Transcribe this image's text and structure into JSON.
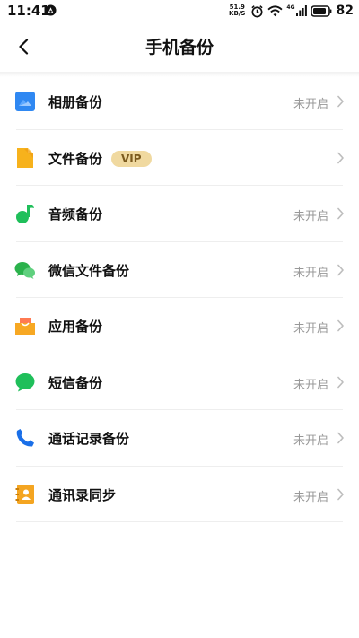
{
  "status_bar": {
    "time": "11:41",
    "net_speed_value": "51.9",
    "net_speed_unit": "KB/S",
    "signal_label": "4G",
    "battery": "82"
  },
  "header": {
    "title": "手机备份"
  },
  "items": [
    {
      "label": "相册备份",
      "status": "未开启",
      "icon": "photo-album-icon"
    },
    {
      "label": "文件备份",
      "status": "",
      "badge": "VIP",
      "icon": "file-icon"
    },
    {
      "label": "音频备份",
      "status": "未开启",
      "icon": "music-note-icon"
    },
    {
      "label": "微信文件备份",
      "status": "未开启",
      "icon": "wechat-icon"
    },
    {
      "label": "应用备份",
      "status": "未开启",
      "icon": "app-box-icon"
    },
    {
      "label": "短信备份",
      "status": "未开启",
      "icon": "message-bubble-icon"
    },
    {
      "label": "通话记录备份",
      "status": "未开启",
      "icon": "phone-icon"
    },
    {
      "label": "通讯录同步",
      "status": "未开启",
      "icon": "contacts-book-icon"
    }
  ],
  "colors": {
    "album_blue": "#2f88f2",
    "file_orange": "#f7b21c",
    "green": "#1fbf5a",
    "wechat_green": "#2bb24c",
    "app_orange": "#f7a823",
    "phone_blue": "#1a6fe8",
    "contacts_orange": "#f4a521",
    "vip_bg": "#f0d9a0"
  }
}
